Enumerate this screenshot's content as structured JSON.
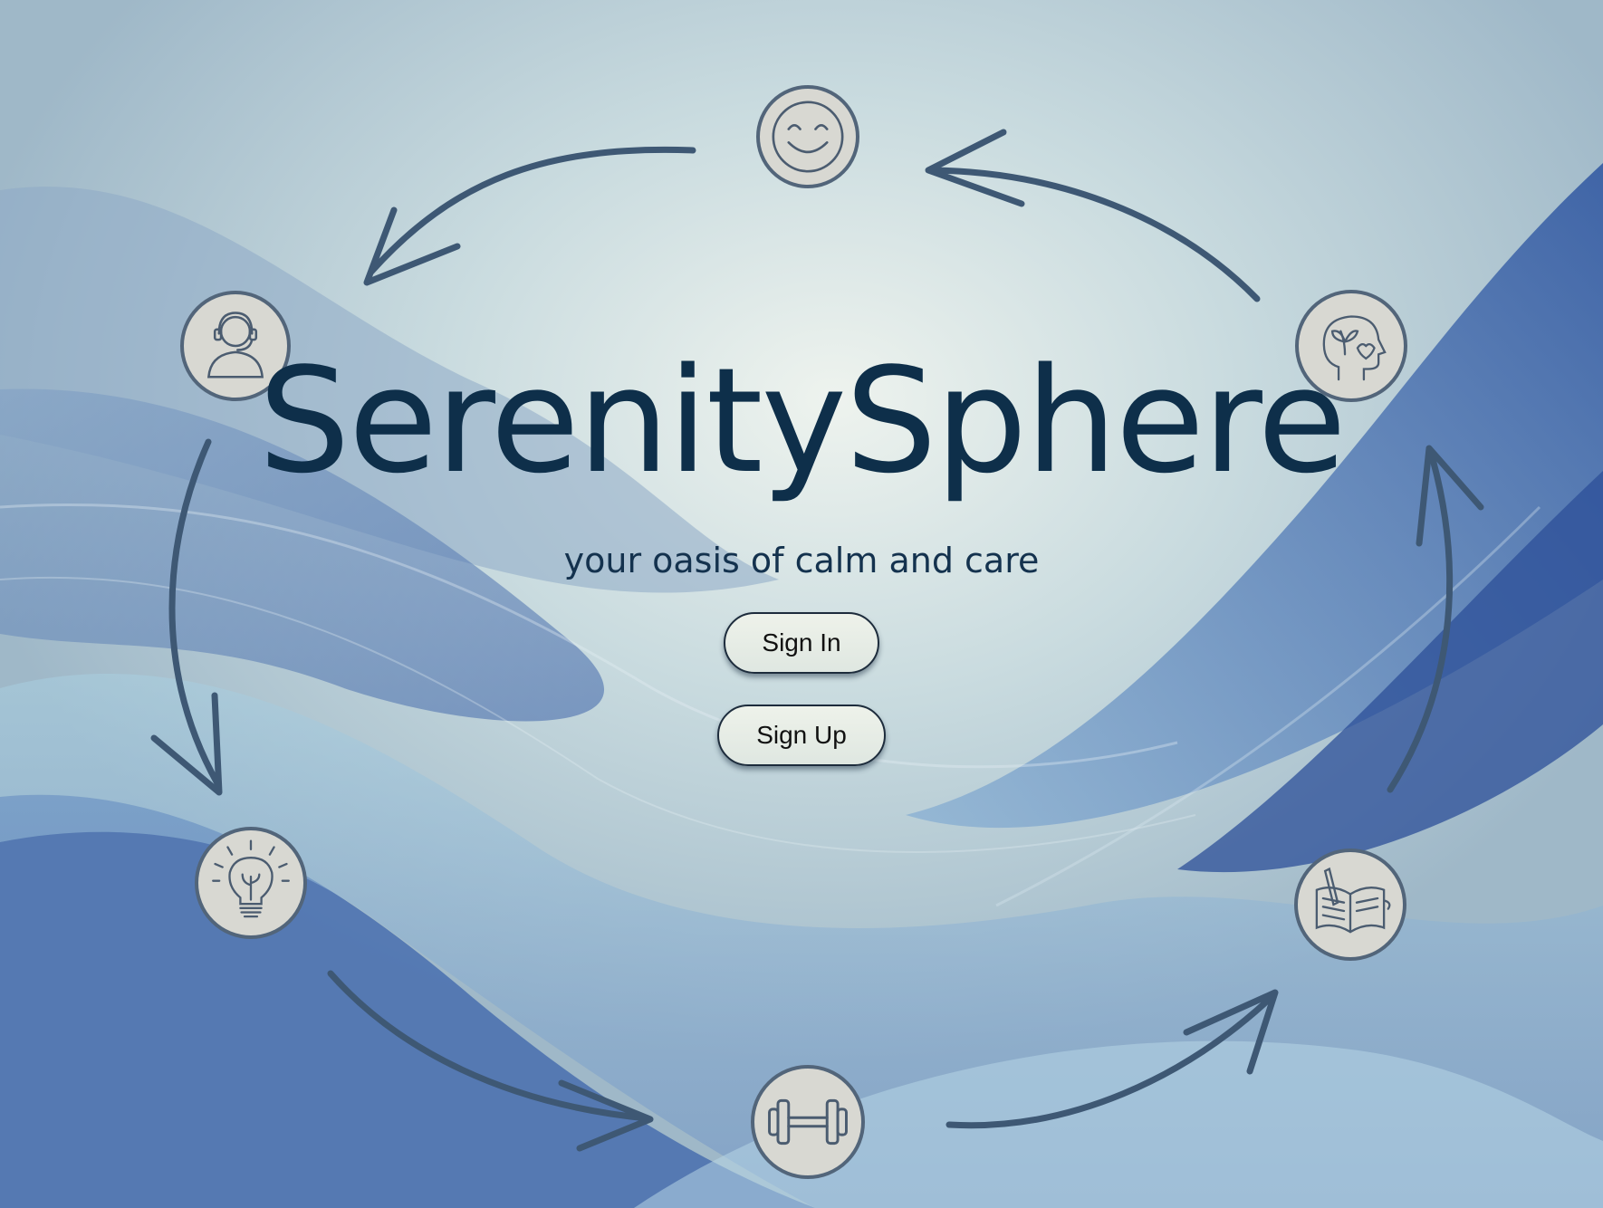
{
  "app": {
    "title": "SerenitySphere",
    "subtitle": "your oasis of calm and care"
  },
  "actions": {
    "sign_in_label": "Sign In",
    "sign_up_label": "Sign Up"
  },
  "cycle_icons": [
    {
      "name": "smiley-face-icon"
    },
    {
      "name": "mind-heart-leaf-icon"
    },
    {
      "name": "journal-book-icon"
    },
    {
      "name": "dumbbell-icon"
    },
    {
      "name": "lightbulb-icon"
    },
    {
      "name": "support-agent-headset-icon"
    }
  ],
  "colors": {
    "title": "#0e2f4a",
    "arrow": "#3e5874",
    "icon_fill": "#d8d8d2",
    "icon_border": "#52657a",
    "button_bg": "#e6ece6"
  }
}
